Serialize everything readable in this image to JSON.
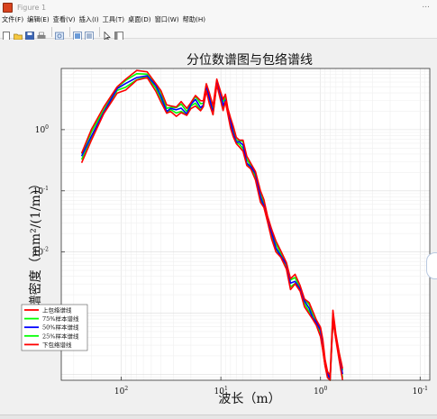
{
  "window": {
    "title": "Figure 1",
    "controls": "..."
  },
  "menu": {
    "items": [
      "文件(F)",
      "编辑(E)",
      "查看(V)",
      "插入(I)",
      "工具(T)",
      "桌面(D)",
      "窗口(W)",
      "帮助(H)"
    ]
  },
  "toolbar": {
    "icons": [
      "new-figure-icon",
      "open-icon",
      "save-icon",
      "print-icon",
      "zoom-icon",
      "layout-icon",
      "data-tips-icon",
      "pointer-icon",
      "panel-icon"
    ]
  },
  "chart_data": {
    "type": "line",
    "title": "分位数谱图与包络谱线",
    "xlabel": "波长（m）",
    "ylabel": "谱密度（mm²/(1/m)）",
    "xscale": "log",
    "yscale": "log",
    "xaxis_reversed": true,
    "xlim": [
      400,
      0.08
    ],
    "ylim": [
      8e-05,
      10
    ],
    "x_ticks": [
      "10^2",
      "10^1",
      "10^0",
      "10^-1"
    ],
    "y_ticks": [
      "10^0",
      "10^-1",
      "10^-2"
    ],
    "grid": true,
    "legend_position": "bottom-left",
    "legend": [
      "上包络谱线",
      "75%样本谱线",
      "50%样本谱线",
      "25%样本谱线",
      "下包络谱线"
    ],
    "series": [
      {
        "name": "上包络谱线",
        "color": "#ff0000"
      },
      {
        "name": "75%样本谱线",
        "color": "#00ff00"
      },
      {
        "name": "50%样本谱线",
        "color": "#0000ff"
      },
      {
        "name": "25%样本谱线",
        "color": "#00ff00"
      },
      {
        "name": "下包络谱线",
        "color": "#ff0000"
      }
    ],
    "wavelength": [
      250,
      200,
      150,
      110,
      90,
      70,
      55,
      45,
      40,
      35,
      32,
      28,
      25,
      22,
      20,
      18,
      16,
      15,
      14,
      13,
      12,
      11,
      10,
      9.5,
      9,
      8.5,
      8,
      7.5,
      7,
      6.5,
      6,
      5.5,
      5,
      4.5,
      4,
      3.7,
      3.4,
      3.1,
      2.8,
      2.5,
      2.2,
      2.0,
      1.8,
      1.6,
      1.45,
      1.3,
      1.2,
      1.1,
      1.0,
      0.95,
      0.9,
      0.85,
      0.8,
      0.75,
      0.7,
      0.65,
      0.6
    ],
    "median_psd": [
      0.35,
      0.8,
      2.0,
      4.5,
      5.5,
      7.5,
      7.8,
      5.0,
      3.5,
      2.1,
      2.2,
      2.0,
      2.3,
      1.9,
      2.5,
      3.0,
      2.4,
      2.6,
      5.0,
      3.2,
      2.0,
      6.0,
      3.5,
      2.5,
      3.2,
      2.0,
      1.3,
      0.9,
      0.65,
      0.6,
      0.55,
      0.3,
      0.25,
      0.18,
      0.08,
      0.06,
      0.035,
      0.02,
      0.012,
      0.009,
      0.006,
      0.003,
      0.0035,
      0.0025,
      0.0015,
      0.0012,
      0.0009,
      0.0007,
      0.0005,
      0.0003,
      0.00015,
      0.0001,
      8e-05,
      0.0009,
      0.0004,
      0.0002,
      0.0001
    ]
  }
}
